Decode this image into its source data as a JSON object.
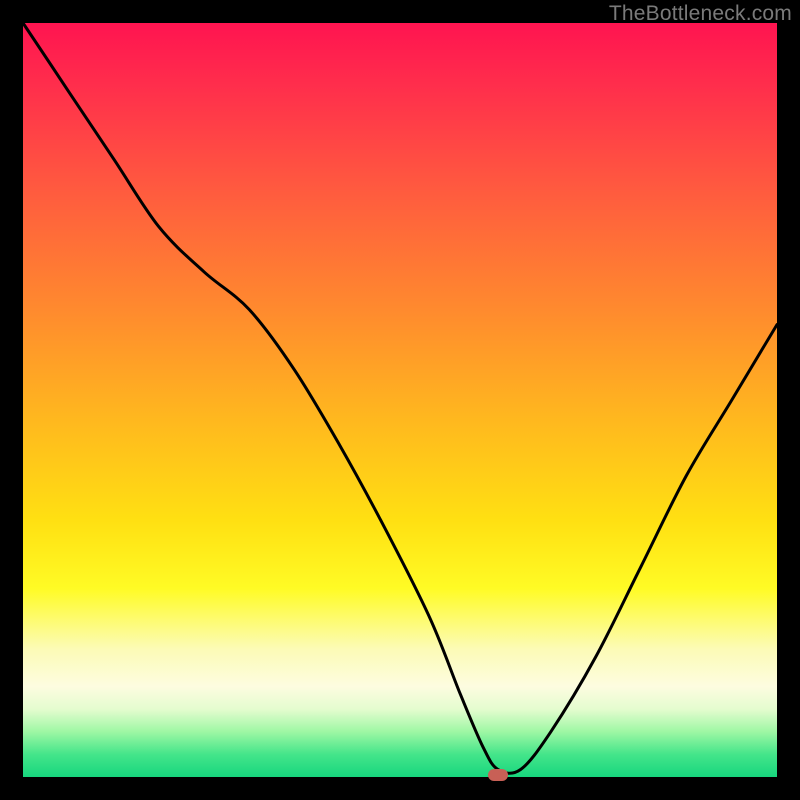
{
  "watermark": "TheBottleneck.com",
  "chart_data": {
    "type": "line",
    "title": "",
    "xlabel": "",
    "ylabel": "",
    "xlim": [
      0,
      100
    ],
    "ylim": [
      0,
      100
    ],
    "grid": false,
    "legend": false,
    "series": [
      {
        "name": "bottleneck-curve",
        "x": [
          0,
          6,
          12,
          18,
          24,
          30,
          36,
          42,
          48,
          54,
          58,
          61,
          63,
          66,
          70,
          76,
          82,
          88,
          94,
          100
        ],
        "values": [
          100,
          91,
          82,
          73,
          67,
          62,
          54,
          44,
          33,
          21,
          11,
          4,
          1,
          1,
          6,
          16,
          28,
          40,
          50,
          60
        ]
      }
    ],
    "marker": {
      "x": 63,
      "y": 0,
      "color": "#c86056"
    },
    "gradient_stops": [
      {
        "pos": 0,
        "color": "#ff1450"
      },
      {
        "pos": 22,
        "color": "#ff5a3f"
      },
      {
        "pos": 52,
        "color": "#ffb61f"
      },
      {
        "pos": 75,
        "color": "#fffb25"
      },
      {
        "pos": 88,
        "color": "#fdfce0"
      },
      {
        "pos": 100,
        "color": "#17d67e"
      }
    ]
  }
}
